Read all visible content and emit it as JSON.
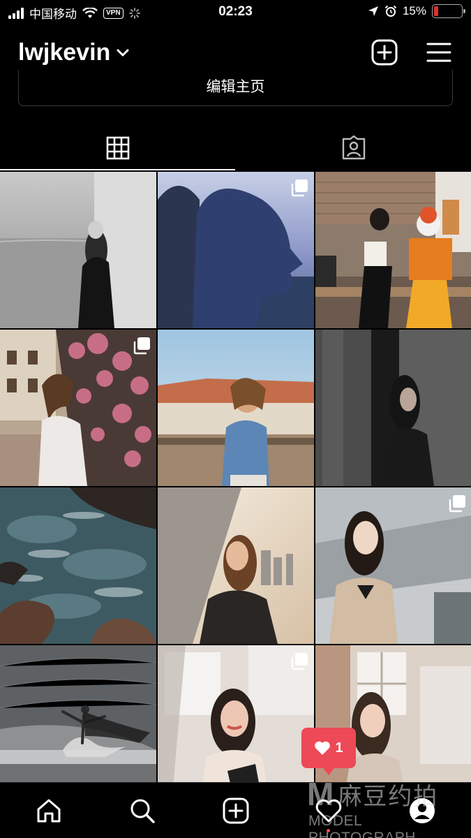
{
  "status_bar": {
    "carrier": "中国移动",
    "vpn": "VPN",
    "time": "02:23",
    "battery_percent": "15%",
    "battery_level": 0.15
  },
  "header": {
    "username": "lwjkevin"
  },
  "profile": {
    "edit_button": "编辑主页"
  },
  "tabs": [
    {
      "name": "grid",
      "icon": "grid-icon",
      "active": true
    },
    {
      "name": "tagged",
      "icon": "tagged-icon",
      "active": false
    }
  ],
  "grid": {
    "posts": [
      {
        "description": "bw-seaside-woman",
        "multi": false
      },
      {
        "description": "silhouette-profile",
        "multi": true
      },
      {
        "description": "woman-bench-clown-statue",
        "multi": false
      },
      {
        "description": "woman-pink-flowers",
        "multi": true
      },
      {
        "description": "woman-denim-rooftop",
        "multi": false
      },
      {
        "description": "woman-dark-corridor",
        "multi": false
      },
      {
        "description": "ocean-rocks",
        "multi": false
      },
      {
        "description": "woman-city-sunlight",
        "multi": false
      },
      {
        "description": "woman-trench-coat",
        "multi": true
      },
      {
        "description": "ballet-dancer",
        "multi": false
      },
      {
        "description": "woman-glass-reflection",
        "multi": true
      },
      {
        "description": "woman-window-light",
        "multi": false
      }
    ]
  },
  "notification": {
    "likes_count": "1"
  },
  "bottom_nav": {
    "items": [
      "home-icon",
      "search-icon",
      "new-post-icon",
      "activity-icon",
      "profile-icon"
    ]
  },
  "watermark": {
    "brand_cn": "麻豆约拍",
    "brand_en": "MODEL PHOTOGRAPH"
  },
  "colors": {
    "background": "#000000",
    "accent_red": "#ed4956",
    "battery_low": "#e0302d"
  }
}
